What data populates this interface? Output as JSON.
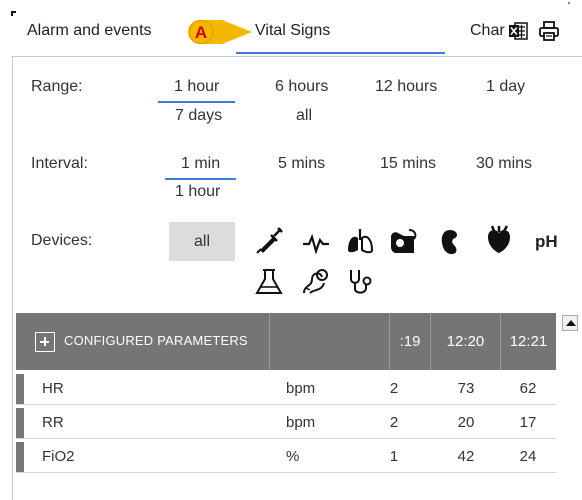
{
  "tabs": {
    "alarm_label": "Alarm and events",
    "vitals_label": "Vital Signs",
    "chart_label": "Char"
  },
  "marker_letter": "A",
  "range": {
    "label": "Range:",
    "options": [
      "1 hour",
      "6 hours",
      "12 hours",
      "1 day",
      "7 days",
      "all"
    ],
    "selected": "1 hour"
  },
  "interval": {
    "label": "Interval:",
    "options": [
      "1 min",
      "5 mins",
      "15 mins",
      "30 mins",
      "1 hour"
    ],
    "selected": "1 min"
  },
  "devices": {
    "label": "Devices:",
    "all_label": "all",
    "icons": [
      "syringe-icon",
      "heartbeat-icon",
      "lungs-icon",
      "pump-icon",
      "kidney-icon",
      "heart-icon",
      "flask-icon",
      "gene-icon",
      "stethoscope-icon"
    ],
    "ph_label": "pH"
  },
  "grid": {
    "header_label": "CONFIGURED PARAMETERS",
    "time_columns": [
      ":19",
      "12:20",
      "12:21"
    ],
    "rows": [
      {
        "name": "HR",
        "unit": "bpm",
        "values": [
          "2",
          "73",
          "62"
        ]
      },
      {
        "name": "RR",
        "unit": "bpm",
        "values": [
          "2",
          "20",
          "17"
        ]
      },
      {
        "name": "FiO2",
        "unit": "%",
        "values": [
          "1",
          "42",
          "24"
        ]
      }
    ]
  },
  "colors": {
    "accent": "#3b7dd8",
    "header_bg": "#757575",
    "marker": "#f5b800",
    "marker_text": "#d40000"
  }
}
